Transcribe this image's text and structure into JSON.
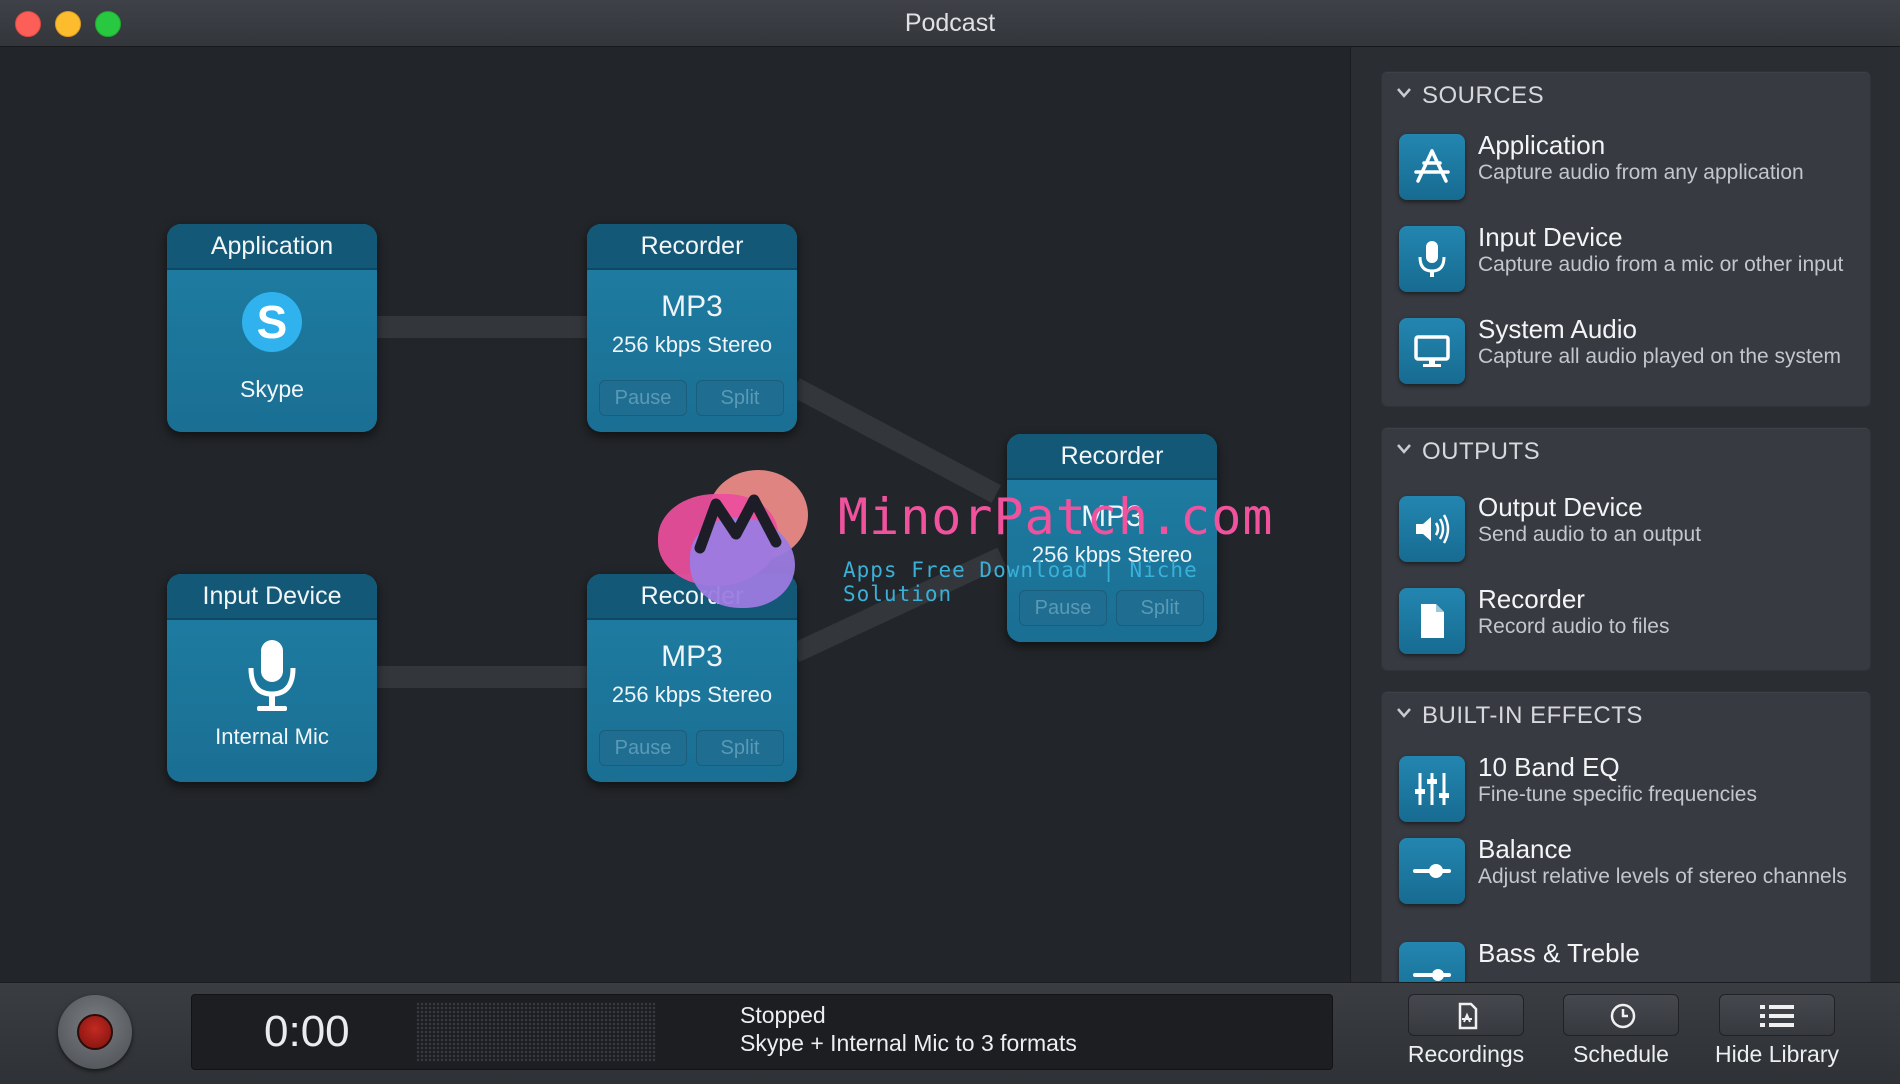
{
  "window": {
    "title": "Podcast"
  },
  "canvas": {
    "sources": [
      {
        "header": "Application",
        "label": "Skype",
        "logo_letter": "S",
        "icon": "skype-logo"
      },
      {
        "header": "Input Device",
        "label": "Internal Mic",
        "icon": "microphone-icon"
      }
    ],
    "recorders": [
      {
        "header": "Recorder",
        "format": "MP3",
        "quality": "256 kbps Stereo",
        "pause": "Pause",
        "split": "Split"
      },
      {
        "header": "Recorder",
        "format": "MP3",
        "quality": "256 kbps Stereo",
        "pause": "Pause",
        "split": "Split"
      },
      {
        "header": "Recorder",
        "format": "MP3",
        "quality": "256 kbps Stereo",
        "pause": "Pause",
        "split": "Split"
      }
    ]
  },
  "watermark": {
    "title": "MinorPatch.com",
    "subtitle": "Apps Free Download | Niche Solution"
  },
  "library": {
    "sources": {
      "title": "SOURCES",
      "items": [
        {
          "name": "Application",
          "desc": "Capture audio from any application",
          "icon": "app-store-icon"
        },
        {
          "name": "Input Device",
          "desc": "Capture audio from a mic or other input",
          "icon": "microphone-icon"
        },
        {
          "name": "System Audio",
          "desc": "Capture all audio played on the system",
          "icon": "monitor-icon"
        }
      ]
    },
    "outputs": {
      "title": "OUTPUTS",
      "items": [
        {
          "name": "Output Device",
          "desc": "Send audio to an output",
          "icon": "speaker-icon"
        },
        {
          "name": "Recorder",
          "desc": "Record audio to files",
          "icon": "document-icon"
        }
      ]
    },
    "effects": {
      "title": "BUILT-IN EFFECTS",
      "items": [
        {
          "name": "10 Band EQ",
          "desc": "Fine-tune specific frequencies",
          "icon": "equalizer-icon"
        },
        {
          "name": "Balance",
          "desc": "Adjust relative levels of stereo channels",
          "icon": "balance-slider-icon"
        },
        {
          "name": "Bass & Treble",
          "desc": "",
          "icon": "bass-treble-slider-icon"
        }
      ]
    }
  },
  "bottombar": {
    "time": "0:00",
    "status_line1": "Stopped",
    "status_line2": "Skype + Internal Mic to 3 formats",
    "buttons": [
      {
        "label": "Recordings",
        "icon": "recordings-icon"
      },
      {
        "label": "Schedule",
        "icon": "clock-icon"
      },
      {
        "label": "Hide Library",
        "icon": "list-icon"
      }
    ]
  },
  "colors": {
    "accent": "#1f7ea4",
    "node_header": "#145877",
    "record_red": "#c22a22",
    "watermark_pink": "#f0529e",
    "watermark_blue": "#3ab0d8"
  }
}
